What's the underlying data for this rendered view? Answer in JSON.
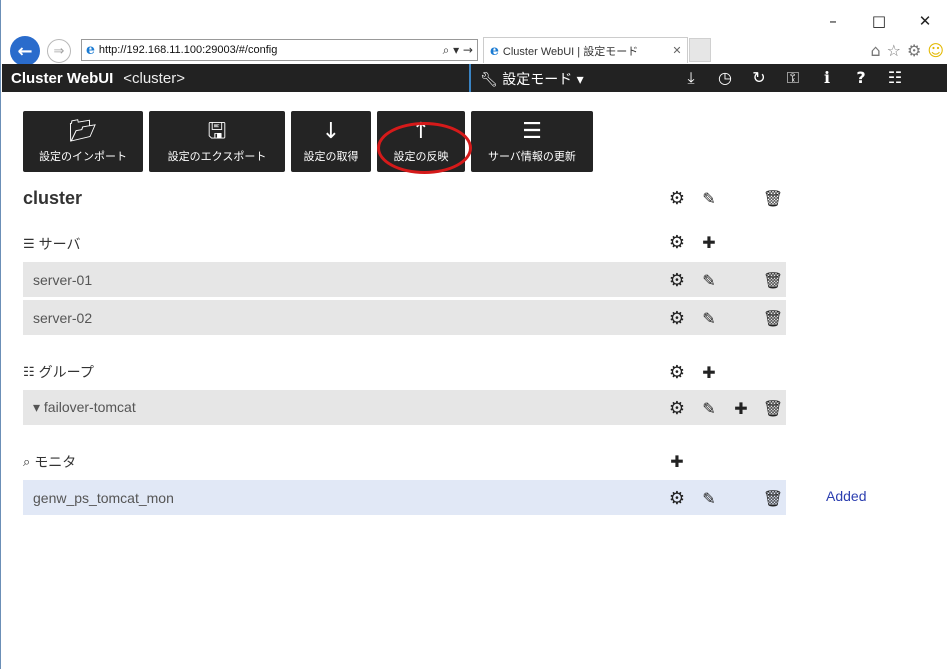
{
  "browser": {
    "url": "http://192.168.11.100:29003/#/config",
    "addr_tools": "⌕ ▾ →",
    "tab_title": "Cluster WebUI | 設定モード",
    "window_controls": {
      "minimize": "–",
      "maximize": "□",
      "close": "✕"
    },
    "icons": [
      "home-icon",
      "star-icon",
      "settings-icon",
      "smiley-icon"
    ]
  },
  "header": {
    "brand": "Cluster WebUI",
    "cluster": "<cluster>",
    "mode": "設定モード ▾",
    "icons": [
      "download-icon",
      "clock-icon",
      "refresh-icon",
      "key-icon",
      "info-icon",
      "help-icon",
      "list-icon"
    ]
  },
  "toolbar": {
    "import_label": "設定のインポート",
    "export_label": "設定のエクスポート",
    "get_label": "設定の取得",
    "apply_label": "設定の反映",
    "update_label": "サーバ情報の更新"
  },
  "cluster": {
    "title": "cluster"
  },
  "servers": {
    "title": "サーバ",
    "items": [
      {
        "name": "server-01"
      },
      {
        "name": "server-02"
      }
    ]
  },
  "groups": {
    "title": "グループ",
    "items": [
      {
        "name": "▾ failover-tomcat"
      }
    ]
  },
  "monitors": {
    "title": "モニタ",
    "items": [
      {
        "name": "genw_ps_tomcat_mon",
        "status": "Added"
      }
    ]
  },
  "colors": {
    "header_bg": "#222222",
    "row_bg": "#e6e6e6",
    "added_row_bg": "#e1e8f6",
    "added_text": "#2c3fb0",
    "highlight": "#d51a1a"
  }
}
